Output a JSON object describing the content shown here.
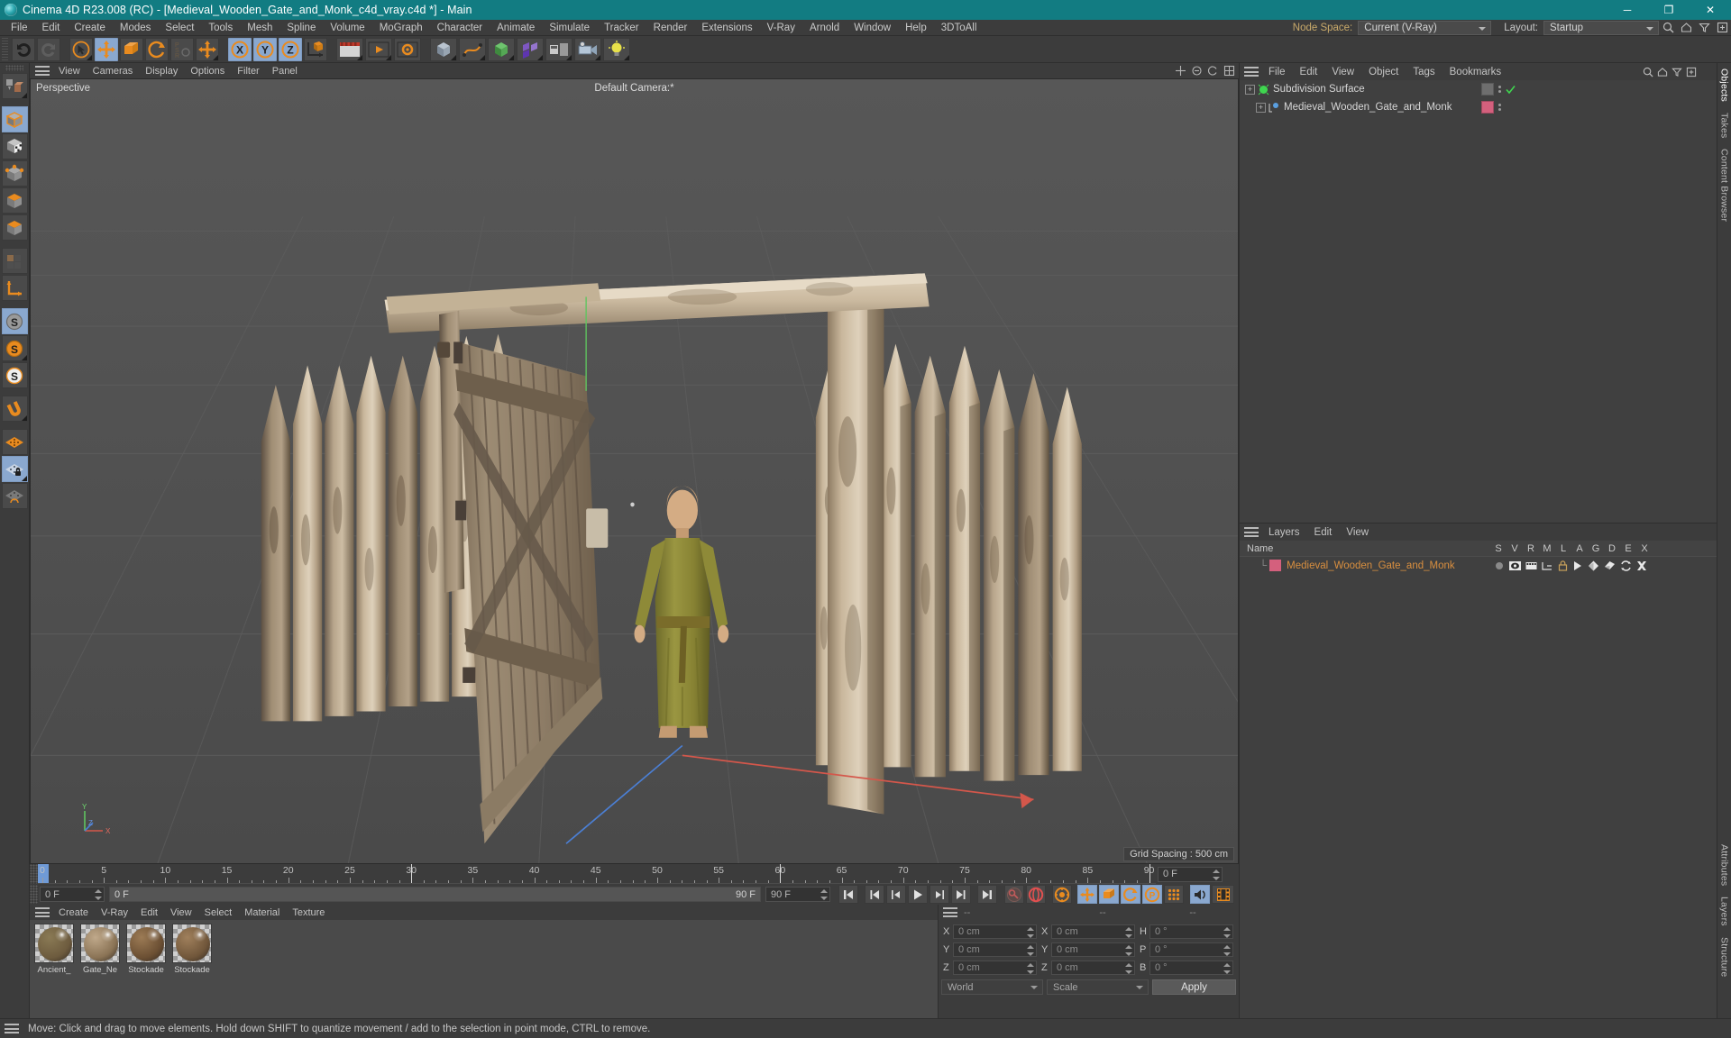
{
  "window": {
    "title": "Cinema 4D R23.008 (RC) - [Medieval_Wooden_Gate_and_Monk_c4d_vray.c4d *] - Main",
    "minimize": "─",
    "maximize": "❐",
    "close": "✕"
  },
  "menubar": {
    "items": [
      "File",
      "Edit",
      "Create",
      "Modes",
      "Select",
      "Tools",
      "Mesh",
      "Spline",
      "Volume",
      "MoGraph",
      "Character",
      "Animate",
      "Simulate",
      "Tracker",
      "Render",
      "Extensions",
      "V-Ray",
      "Arnold",
      "Window",
      "Help",
      "3DToAll"
    ],
    "node_space_label": "Node Space:",
    "node_space_value": "Current (V-Ray)",
    "layout_label": "Layout:",
    "layout_value": "Startup"
  },
  "toolbar": {
    "buttons": [
      {
        "name": "undo-button",
        "icon": "undo"
      },
      {
        "name": "redo-button",
        "icon": "redo"
      },
      {
        "name": "live-selection-tool",
        "icon": "cursor-circle"
      },
      {
        "name": "move-tool",
        "icon": "move-arrows",
        "active": true
      },
      {
        "name": "scale-tool",
        "icon": "scale-box"
      },
      {
        "name": "rotate-tool",
        "icon": "rotate-circle"
      },
      {
        "name": "psr-tool",
        "icon": "psr"
      },
      {
        "name": "world-object-axis",
        "icon": "move-arrows"
      },
      {
        "name": "lock-x-axis",
        "icon": "axis-x",
        "active": true
      },
      {
        "name": "lock-y-axis",
        "icon": "axis-y",
        "active": true
      },
      {
        "name": "lock-z-axis",
        "icon": "axis-z",
        "active": true
      },
      {
        "name": "world-coordinate-system",
        "icon": "world-axis"
      },
      {
        "name": "render-view-button",
        "icon": "render-view"
      },
      {
        "name": "render-to-picture-viewer",
        "icon": "render-picture"
      },
      {
        "name": "edit-render-settings",
        "icon": "render-settings"
      },
      {
        "name": "add-cube-button",
        "icon": "cube"
      },
      {
        "name": "add-spline-button",
        "icon": "spline-pen"
      },
      {
        "name": "add-generator-button",
        "icon": "generator"
      },
      {
        "name": "add-deformer-button",
        "icon": "deformer"
      },
      {
        "name": "add-scene-object-button",
        "icon": "scene-env"
      },
      {
        "name": "add-camera-button",
        "icon": "camera"
      },
      {
        "name": "add-light-button",
        "icon": "light-bulb"
      }
    ]
  },
  "left_toolbar": {
    "buttons": [
      {
        "name": "make-editable",
        "icon": "make-editable"
      },
      {
        "name": "model-mode",
        "icon": "model-cube",
        "active": true
      },
      {
        "name": "texture-mode",
        "icon": "texture-cube"
      },
      {
        "name": "point-mode",
        "icon": "point-cube"
      },
      {
        "name": "edge-mode",
        "icon": "edge-cube"
      },
      {
        "name": "polygon-mode",
        "icon": "polygon-cube"
      },
      {
        "name": "uv-mode",
        "icon": "uv-mode"
      },
      {
        "name": "axis-mode",
        "icon": "axis-l"
      },
      {
        "name": "enable-axis-s1",
        "icon": "s-grey",
        "active": true
      },
      {
        "name": "enable-axis-s2",
        "icon": "s-orange"
      },
      {
        "name": "enable-axis-s3",
        "icon": "s-white"
      },
      {
        "name": "snap-magnet",
        "icon": "magnet"
      },
      {
        "name": "workplane-orange",
        "icon": "plane-orange"
      },
      {
        "name": "workplane-lock",
        "icon": "plane-lock",
        "active": true
      },
      {
        "name": "workplane-reset",
        "icon": "plane-reset"
      }
    ]
  },
  "viewport": {
    "menu": [
      "View",
      "Cameras",
      "Display",
      "Options",
      "Filter",
      "Panel"
    ],
    "label": "Perspective",
    "camera": "Default Camera:*",
    "grid_spacing": "Grid Spacing : 500 cm",
    "axis_labels": {
      "x": "X",
      "y": "Y",
      "z": "Z"
    }
  },
  "timeline": {
    "ticks": [
      0,
      5,
      10,
      15,
      20,
      25,
      30,
      35,
      40,
      45,
      50,
      55,
      60,
      65,
      70,
      75,
      80,
      85,
      90
    ],
    "current_frame": "0 F",
    "start_frame": "0 F",
    "end_frame": "90 F",
    "preview_min": "0 F",
    "preview_max": "90 F",
    "range_end": "90 F"
  },
  "playback": {
    "buttons": [
      {
        "name": "go-to-start-button",
        "icon": "skip-back"
      },
      {
        "name": "go-to-previous-key-button",
        "icon": "prev-key"
      },
      {
        "name": "step-back-button",
        "icon": "step-back"
      },
      {
        "name": "play-button",
        "icon": "play"
      },
      {
        "name": "step-forward-button",
        "icon": "step-forward"
      },
      {
        "name": "go-to-next-key-button",
        "icon": "next-key"
      },
      {
        "name": "go-to-end-button",
        "icon": "skip-forward"
      },
      {
        "name": "record-active-objects-button",
        "icon": "key-record"
      },
      {
        "name": "autokeying-button",
        "icon": "autokey"
      },
      {
        "name": "keyframe-selection-button",
        "icon": "keyframe-sel"
      },
      {
        "name": "position-key-button",
        "icon": "pos-key",
        "active": true
      },
      {
        "name": "scale-key-button",
        "icon": "scale-key",
        "active": true
      },
      {
        "name": "rotation-key-button",
        "icon": "rot-key",
        "active": true
      },
      {
        "name": "param-key-button",
        "icon": "param-key",
        "active": true
      },
      {
        "name": "point-level-animation-button",
        "icon": "pla-dots"
      },
      {
        "name": "sound-button",
        "icon": "sound",
        "active": true
      },
      {
        "name": "filmstrip-button",
        "icon": "filmstrip"
      }
    ]
  },
  "material_manager": {
    "menu": [
      "Create",
      "V-Ray",
      "Edit",
      "View",
      "Select",
      "Material",
      "Texture"
    ],
    "materials": [
      {
        "name": "Ancient_",
        "color1": "#8a7a55",
        "color2": "#6d5b3e"
      },
      {
        "name": "Gate_Ne",
        "color1": "#c0a98b",
        "color2": "#8a7355"
      },
      {
        "name": "Stockade",
        "color1": "#9c7b55",
        "color2": "#6b4f33"
      },
      {
        "name": "Stockade",
        "color1": "#a0805c",
        "color2": "#70563a"
      }
    ]
  },
  "coordinates": {
    "header_dashes": [
      "--",
      "--",
      "--"
    ],
    "rows": [
      {
        "label_pos": "X",
        "value_pos": "0 cm",
        "label_size": "X",
        "value_size": "0 cm",
        "label_rot": "H",
        "value_rot": "0 °"
      },
      {
        "label_pos": "Y",
        "value_pos": "0 cm",
        "label_size": "Y",
        "value_size": "0 cm",
        "label_rot": "P",
        "value_rot": "0 °"
      },
      {
        "label_pos": "Z",
        "value_pos": "0 cm",
        "label_size": "Z",
        "value_size": "0 cm",
        "label_rot": "B",
        "value_rot": "0 °"
      }
    ],
    "system": "World",
    "mode": "Scale",
    "apply": "Apply"
  },
  "object_manager": {
    "menu": [
      "File",
      "Edit",
      "View",
      "Object",
      "Tags",
      "Bookmarks"
    ],
    "rows": [
      {
        "name": "Subdivision Surface",
        "color": "#cfcfcf",
        "icon": "subdivision-surface",
        "indent": 0,
        "has_check": true,
        "tag_color": "#8a8a8a"
      },
      {
        "name": "Medieval_Wooden_Gate_and_Monk",
        "color": "#cfcfcf",
        "icon": "null-object",
        "indent": 1,
        "has_check": false,
        "tag_color": "#d4607d"
      }
    ]
  },
  "layers_manager": {
    "menu": [
      "Layers",
      "Edit",
      "View"
    ],
    "columns": [
      "Name",
      "S",
      "V",
      "R",
      "M",
      "L",
      "A",
      "G",
      "D",
      "E",
      "X"
    ],
    "rows": [
      {
        "name": "Medieval_Wooden_Gate_and_Monk",
        "swatch": "#d4607d"
      }
    ]
  },
  "right_tabs": [
    {
      "label": "Objects",
      "selected": true
    },
    {
      "label": "Takes",
      "selected": false
    },
    {
      "label": "Content Browser",
      "selected": false
    },
    {
      "label": "Attributes",
      "selected": false
    },
    {
      "label": "Layers",
      "selected": false
    },
    {
      "label": "Structure",
      "selected": false
    }
  ],
  "statusbar": {
    "message": "Move: Click and drag to move elements. Hold down SHIFT to quantize movement / add to the selection in point mode, CTRL to remove."
  },
  "colors": {
    "titlebar": "#127c82",
    "panel": "#3c3c3c",
    "active_button": "#8aa8cf",
    "accent_orange": "#e98b1f",
    "layer_pink": "#d4607d",
    "layer_text": "#d98f3f"
  }
}
